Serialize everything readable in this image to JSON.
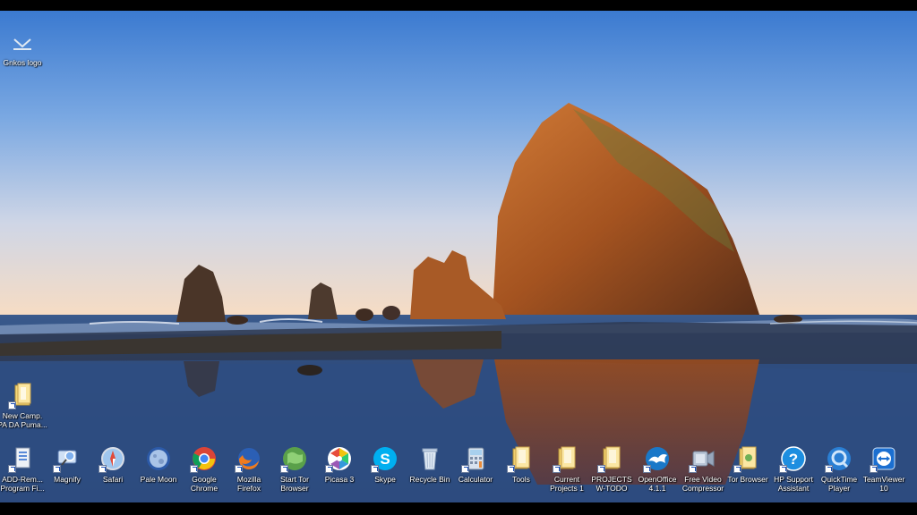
{
  "desktop": {
    "top_left": {
      "label": "Gnkos logo",
      "icon": "logo-icon"
    },
    "left_column": [
      {
        "label": "New Camp.\nPA DA Puma...",
        "icon": "folder-icon"
      }
    ],
    "taskbar_row": [
      {
        "label": "ADD-Rem...\nProgram Fi...",
        "icon": "control-panel-icon"
      },
      {
        "label": "Magnify",
        "icon": "magnify-icon"
      },
      {
        "label": "Safari",
        "icon": "safari-icon"
      },
      {
        "label": "Pale Moon",
        "icon": "pale-moon-icon"
      },
      {
        "label": "Google\nChrome",
        "icon": "chrome-icon"
      },
      {
        "label": "Mozilla\nFirefox",
        "icon": "firefox-icon"
      },
      {
        "label": "Start Tor\nBrowser",
        "icon": "tor-globe-icon"
      },
      {
        "label": "Picasa 3",
        "icon": "picasa-icon"
      },
      {
        "label": "Skype",
        "icon": "skype-icon"
      },
      {
        "label": "Recycle Bin",
        "icon": "recycle-bin-icon"
      },
      {
        "label": "Calculator",
        "icon": "calculator-icon"
      },
      {
        "label": "Tools",
        "icon": "folder-icon"
      },
      {
        "label": "Current\nProjects 1",
        "icon": "folder-icon"
      },
      {
        "label": "PROJECTS\nW-TODO",
        "icon": "folder-icon"
      },
      {
        "label": "OpenOffice\n4.1.1",
        "icon": "openoffice-icon"
      },
      {
        "label": "Free Video\nCompressor",
        "icon": "video-compressor-icon"
      },
      {
        "label": "Tor Browser",
        "icon": "folder-icon"
      },
      {
        "label": "HP Support\nAssistant",
        "icon": "help-icon"
      },
      {
        "label": "QuickTime\nPlayer",
        "icon": "quicktime-icon"
      },
      {
        "label": "TeamViewer\n10",
        "icon": "teamviewer-icon"
      }
    ]
  },
  "colors": {
    "sky_top": "#3f7fd0",
    "sky_bottom": "#f4e0c8",
    "rock": "#a5511c",
    "water": "#2c4a78"
  }
}
